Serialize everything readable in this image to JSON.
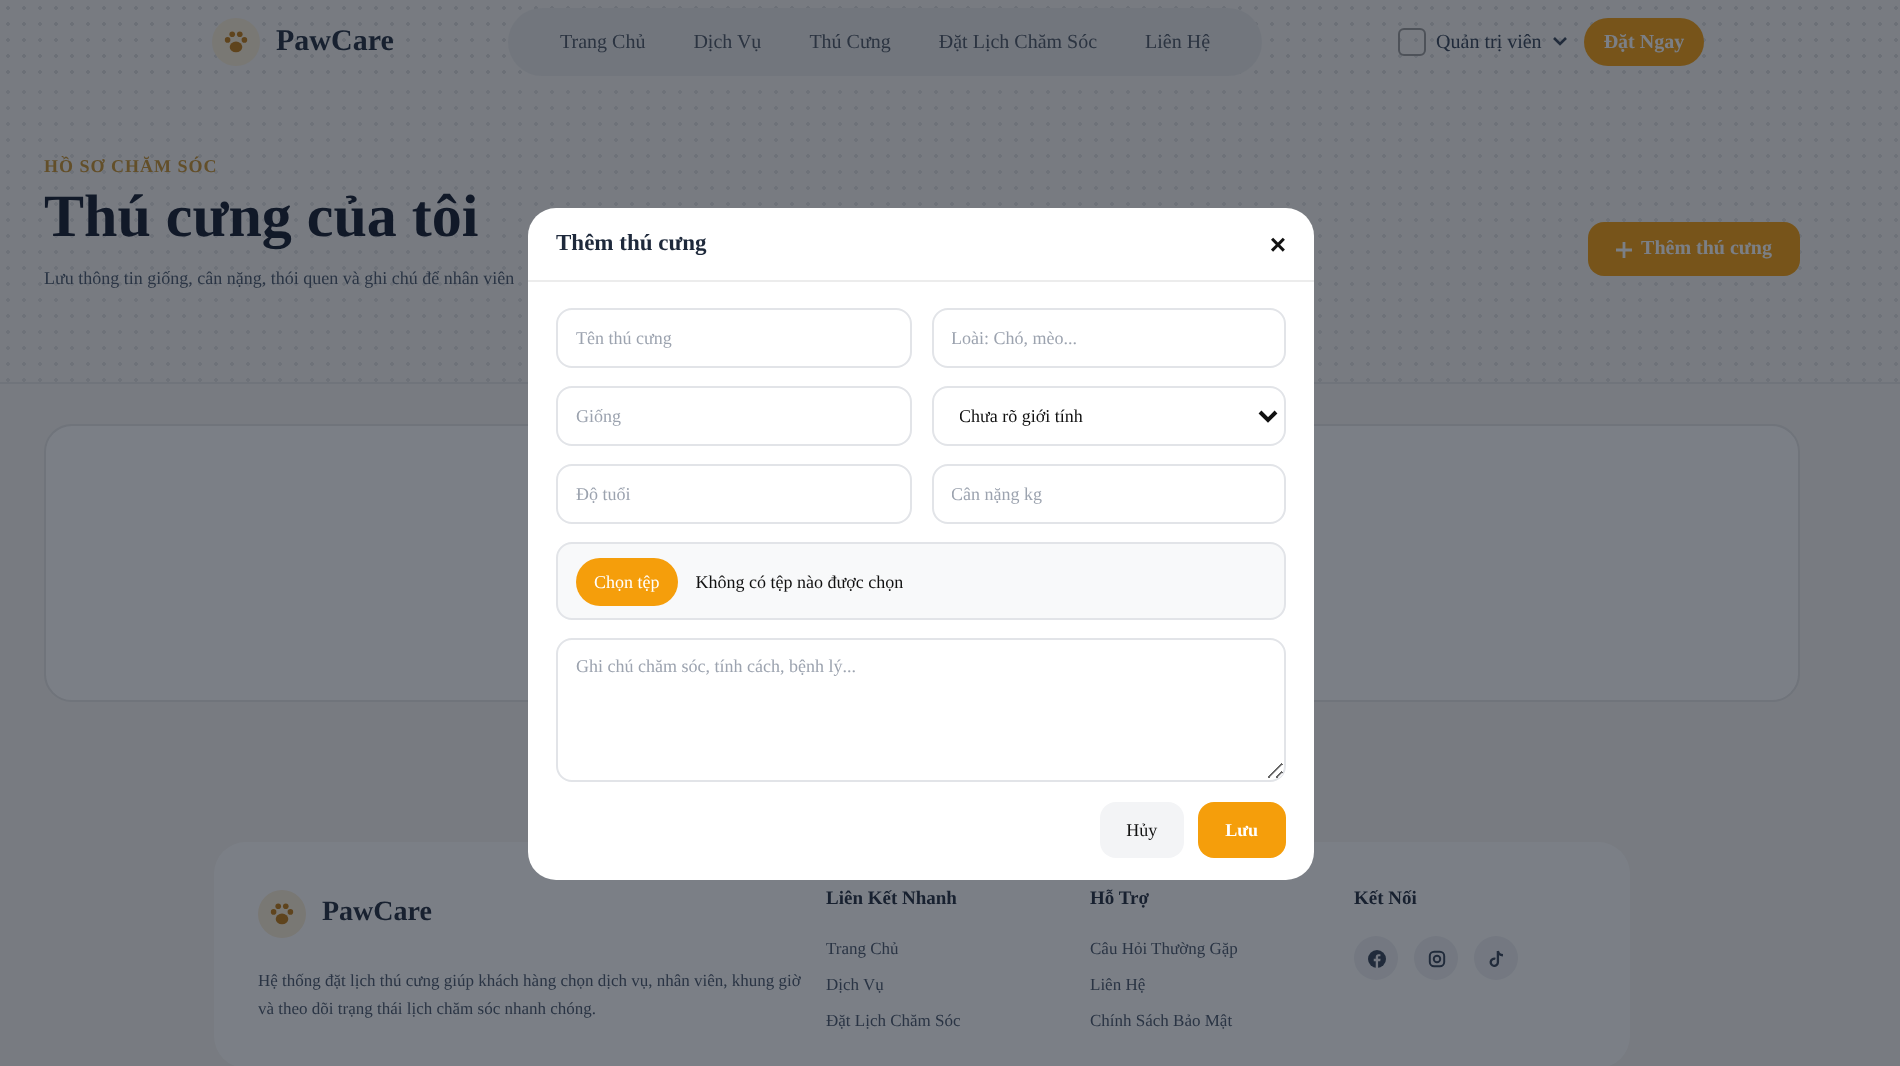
{
  "header": {
    "brand": "PawCare",
    "nav": [
      "Trang Chủ",
      "Dịch Vụ",
      "Thú Cưng",
      "Đặt Lịch Chăm Sóc",
      "Liên Hệ"
    ],
    "user": "Quản trị viên",
    "cta": "Đặt Ngay"
  },
  "hero": {
    "eyebrow": "HỒ SƠ CHĂM SÓC",
    "title": "Thú cưng của tôi",
    "description": "Lưu thông tin giống, cân nặng, thói quen và ghi chú để nhân viên",
    "add_button": "Thêm thú cưng"
  },
  "modal": {
    "title": "Thêm thú cưng",
    "close": "×",
    "fields": [
      {
        "kind": "input",
        "placeholder": "Tên thú cưng"
      },
      {
        "kind": "input",
        "placeholder": "Loài: Chó, mèo..."
      },
      {
        "kind": "input",
        "placeholder": "Giống"
      },
      {
        "kind": "select",
        "value": "Chưa rõ giới tính"
      },
      {
        "kind": "input",
        "placeholder": "Độ tuổi"
      },
      {
        "kind": "input",
        "placeholder": "Cân nặng kg"
      }
    ],
    "file": {
      "button": "Chọn tệp",
      "status": "Không có tệp nào được chọn"
    },
    "notes": {
      "placeholder": "Ghi chú chăm sóc, tính cách, bệnh lý..."
    },
    "buttons": [
      {
        "label": "Hủy",
        "kind": "secondary"
      },
      {
        "label": "Lưu",
        "kind": "primary"
      }
    ]
  },
  "footer": {
    "brand": "PawCare",
    "description": "Hệ thống đặt lịch thú cưng giúp khách hàng chọn dịch vụ, nhân viên, khung giờ và theo dõi trạng thái lịch chăm sóc nhanh chóng.",
    "columns": [
      {
        "title": "Liên Kết Nhanh",
        "links": [
          "Trang Chủ",
          "Dịch Vụ",
          "Đặt Lịch Chăm Sóc"
        ]
      },
      {
        "title": "Hỗ Trợ",
        "links": [
          "Câu Hỏi Thường Gặp",
          "Liên Hệ",
          "Chính Sách Bảo Mật"
        ]
      }
    ],
    "connect": "Kết Nối"
  }
}
